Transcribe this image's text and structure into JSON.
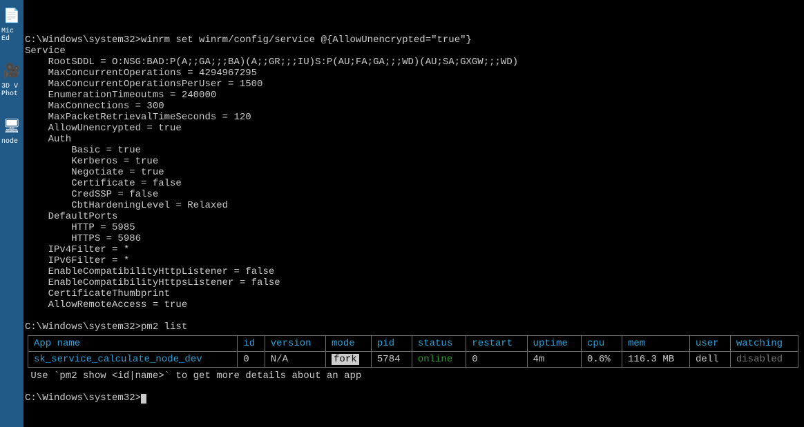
{
  "desktop": {
    "icons": [
      {
        "glyph": "📄",
        "color": "#5aa0e0",
        "label": "Mic\nEd"
      },
      {
        "glyph": "🎥",
        "color": "#bbbbbb",
        "label": "3D V\nPhot"
      },
      {
        "glyph": "🖥",
        "color": "#dddddd",
        "label": "node"
      }
    ]
  },
  "terminal": {
    "cmd1": "C:\\Windows\\system32>winrm set winrm/config/service @{AllowUnencrypted=\"true\"}",
    "output_lines": [
      "Service",
      "    RootSDDL = O:NSG:BAD:P(A;;GA;;;BA)(A;;GR;;;IU)S:P(AU;FA;GA;;;WD)(AU;SA;GXGW;;;WD)",
      "    MaxConcurrentOperations = 4294967295",
      "    MaxConcurrentOperationsPerUser = 1500",
      "    EnumerationTimeoutms = 240000",
      "    MaxConnections = 300",
      "    MaxPacketRetrievalTimeSeconds = 120",
      "    AllowUnencrypted = true",
      "    Auth",
      "        Basic = true",
      "        Kerberos = true",
      "        Negotiate = true",
      "        Certificate = false",
      "        CredSSP = false",
      "        CbtHardeningLevel = Relaxed",
      "    DefaultPorts",
      "        HTTP = 5985",
      "        HTTPS = 5986",
      "    IPv4Filter = *",
      "    IPv6Filter = *",
      "    EnableCompatibilityHttpListener = false",
      "    EnableCompatibilityHttpsListener = false",
      "    CertificateThumbprint",
      "    AllowRemoteAccess = true"
    ],
    "cmd2": "C:\\Windows\\system32>pm2 list",
    "pm2_table": {
      "headers": [
        "App name",
        "id",
        "version",
        "mode",
        "pid",
        "status",
        "restart",
        "uptime",
        "cpu",
        "mem",
        "user",
        "watching"
      ],
      "row": {
        "app_name": "sk_service_calculate_node_dev",
        "id": "0",
        "version": "N/A",
        "mode": "fork",
        "pid": "5784",
        "status": "online",
        "restart": "0",
        "uptime": "4m",
        "cpu": "0.6%",
        "mem": "116.3 MB",
        "user": "dell",
        "watching": "disabled"
      }
    },
    "hint": " Use `pm2 show <id|name>` to get more details about an app",
    "cmd3": "C:\\Windows\\system32>"
  }
}
